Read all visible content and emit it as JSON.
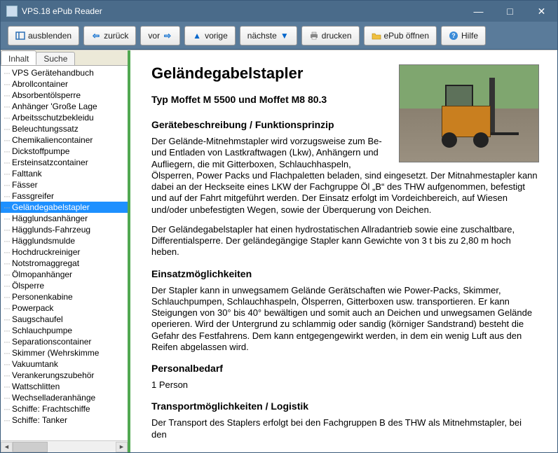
{
  "window": {
    "title": "VPS.18 ePub Reader"
  },
  "toolbar": {
    "hide": "ausblenden",
    "back": "zurück",
    "forward": "vor",
    "prev": "vorige",
    "next": "nächste",
    "print": "drucken",
    "open": "ePub öffnen",
    "help": "Hilfe"
  },
  "tabs": {
    "content": "Inhalt",
    "search": "Suche"
  },
  "tree": {
    "items": [
      "VPS Gerätehandbuch",
      "Abrollcontainer",
      "Absorbentölsperre",
      "Anhänger 'Große Lage",
      "Arbeitsschutzbekleidu",
      "Beleuchtungssatz",
      "Chemikaliencontainer",
      "Dickstoffpumpe",
      "Ersteinsatzcontainer",
      "Falttank",
      "Fässer",
      "Fassgreifer",
      "Geländegabelstapler",
      "Hägglundsanhänger",
      "Hägglunds-Fahrzeug",
      "Hägglundsmulde",
      "Hochdruckreiniger",
      "Notstromaggregat",
      "Ölmopanhänger",
      "Ölsperre",
      "Personenkabine",
      "Powerpack",
      "Saugschaufel",
      "Schlauchpumpe",
      "Separationscontainer",
      "Skimmer (Wehrskimme",
      "Vakuumtank",
      "Verankerungszubehör",
      "Wattschlitten",
      "Wechselladeranhänge",
      "Schiffe: Frachtschiffe",
      "Schiffe: Tanker"
    ],
    "selected": "Geländegabelstapler"
  },
  "article": {
    "title": "Geländegabelstapler",
    "subtitle": "Typ Moffet M 5500 und Moffet M8 80.3",
    "h_desc": "Gerätebeschreibung / Funktionsprinzip",
    "p_desc1": "Der Gelände-Mitnehmstapler wird vorzugsweise zum Be- und Entladen von Lastkraftwagen (Lkw), Anhängern und Aufliegern, die mit Gitterboxen, Schlauchhaspeln, Ölsperren, Power Packs und Flachpaletten beladen, sind eingesetzt. Der Mitnahmestapler kann dabei an der Heckseite eines LKW  der Fachgruppe Öl „B“ des THW aufgenommen, befestigt und auf der Fahrt mitgeführt werden. Der Einsatz erfolgt im Vordeichbereich, auf  Wiesen und/oder unbefestigten Wegen, sowie der Überquerung von Deichen.",
    "p_desc2": "Der Geländegabelstapler hat einen hydrostatischen Allradantrieb sowie eine zuschaltbare, Differentialsperre. Der geländegängige Stapler kann Gewichte von 3 t  bis zu 2,80 m hoch heben.",
    "h_use": "Einsatzmöglichkeiten",
    "p_use": "Der Stapler kann in unwegsamem Gelände Gerätschaften wie Power-Packs, Skimmer, Schlauchpumpen, Schlauchhaspeln, Ölsperren, Gitterboxen usw. transportieren. Er kann Steigungen von 30° bis 40° bewältigen und somit auch an Deichen und unwegsamen Gelände operieren. Wird der Untergrund zu schlammig oder sandig (körniger Sandstrand) besteht die Gefahr des Festfahrens. Dem kann entgegengewirkt werden, in dem ein wenig Luft aus den Reifen abgelassen wird.",
    "h_pers": "Personalbedarf",
    "p_pers": "1 Person",
    "h_trans": "Transportmöglichkeiten / Logistik",
    "p_trans": "Der Transport des Staplers erfolgt bei den Fachgruppen B des THW als Mitnehmstapler, bei den"
  }
}
